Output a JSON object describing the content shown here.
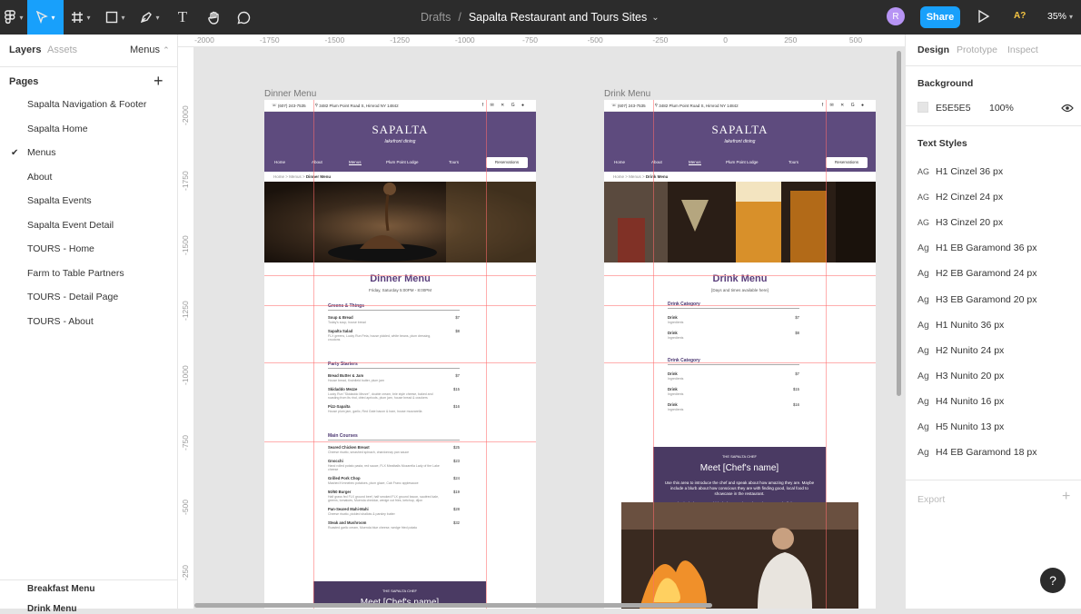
{
  "toolbar": {
    "main_menu_icon": "figma-icon",
    "move_icon": "cursor-icon",
    "frame_icon": "frame-icon",
    "shape_icon": "rectangle-icon",
    "pen_icon": "pen-icon",
    "text_icon": "T",
    "hand_icon": "hand-icon",
    "comment_icon": "comment-icon"
  },
  "breadcrumb": {
    "folder": "Drafts",
    "separator": "/",
    "file": "Sapalta Restaurant and Tours Sites",
    "chevron": "⌄"
  },
  "user": {
    "avatar": "R"
  },
  "share_label": "Share",
  "present_icon": "play-icon",
  "accessibility_label": "A?",
  "zoom_label": "35%",
  "left_panel": {
    "tab_layers": "Layers",
    "tab_assets": "Assets",
    "page_dropdown": "Menus",
    "chevron": "⌃",
    "pages_header": "Pages",
    "add_page": "+",
    "pages": [
      "Sapalta Navigation & Footer",
      "Sapalta Home",
      "Menus",
      "About",
      "Sapalta Events",
      "Sapalta Event Detail",
      "TOURS - Home",
      "Farm to Table Partners",
      "TOURS - Detail Page",
      "TOURS - About"
    ],
    "active_check": "✔",
    "layer_bottom_1": "Breakfast Menu",
    "layer_bottom_2": "Drink Menu"
  },
  "ruler": {
    "top": [
      "-2000",
      "-1750",
      "-1500",
      "-1250",
      "-1000",
      "-750",
      "-500",
      "-250",
      "0",
      "250",
      "500"
    ],
    "left": [
      "-2000",
      "-1750",
      "-1500",
      "-1250",
      "-1000",
      "-750",
      "-500",
      "-250"
    ]
  },
  "frames": [
    {
      "label": "Dinner Menu",
      "phone": "(607) 243-7535",
      "address": "3482 Plum Point Road S, Himrod NY 14842",
      "icons": "f ✉ ✕ G ●",
      "logo": "SAPALTA",
      "tagline": "lakefront dining",
      "nav": [
        "Home",
        "About",
        "Menus",
        "Plum Point Lodge",
        "Tours"
      ],
      "reservations": "Reservations",
      "crumb_home": "Home",
      "crumb_menus": "Menus",
      "crumb_sep": ">",
      "crumb_current": "Dinner Menu",
      "title": "Dinner Menu",
      "subtitle": "Friday, Saturday 5:00PM - 8:00PM",
      "sections": [
        {
          "name": "Greens & Things",
          "items": [
            {
              "name": "Soup & Bread",
              "desc": "Today's soup, house bread",
              "price": "$7"
            },
            {
              "name": "Sapalta Salad",
              "desc": "FLX greens, Lucky Run Feta, house pickled, white beans, plum dressing, croutons",
              "price": "$8"
            }
          ]
        },
        {
          "name": "Party Starters",
          "items": [
            {
              "name": "Bread Butter & Jam",
              "desc": "House bread, Kwinfield butter, plum jam",
              "price": "$7"
            },
            {
              "name": "Skidaddo Mezze",
              "desc": "Lucky Run \"Skidaddo Mezze\", double cream, brie style cheese, baked and roasting from its rind, dried apricots, plum jam, house bread & crackers",
              "price": "$15"
            },
            {
              "name": "Pizz-Sapalta",
              "desc": "House plum jam, garlic, Red Gate bacon & ham, house mozzarella",
              "price": "$16"
            }
          ]
        },
        {
          "name": "Main Courses",
          "items": [
            {
              "name": "Seared Chicken Breast",
              "desc": "Cheese risotto, smashed spinach, chardonnay pan sauce",
              "price": "$25"
            },
            {
              "name": "Gnocchi",
              "desc": "Hand rolled potato pasta, red sauce, FLX Meatballs Mozarella Lady of the Lake cheese",
              "price": "$23"
            },
            {
              "name": "Grilled Pork Chop",
              "desc": "Mashed Kennebec potatoes, plum glaze, Cab Franc applesauce",
              "price": "$24"
            },
            {
              "name": "50/50 Burger",
              "desc": "Half grass fed FLX ground beef, half smoked FLX ground bacon, sautéed kale, greens, tomatoes, Muenda cheddar, wedge cut fries, ketchup, dijon",
              "price": "$19"
            },
            {
              "name": "Pan-Seared Mahi-Mahi",
              "desc": "Cheese risotto, pickled shallots & parsley butter",
              "price": "$28"
            },
            {
              "name": "Steak and Mushroom",
              "desc": "Roasted garlic cream, Muenda blue cheese, wedge fried potato",
              "price": "$32"
            }
          ]
        }
      ],
      "chef_kicker": "THE SAPALTA CHEF",
      "chef_name": "Meet [Chef's name]"
    },
    {
      "label": "Drink Menu",
      "phone": "(607) 243-7535",
      "address": "3482 Plum Point Road S, Himrod NY 14842",
      "icons": "f ✉ ✕ G ●",
      "logo": "SAPALTA",
      "tagline": "lakefront dining",
      "nav": [
        "Home",
        "About",
        "Menus",
        "Plum Point Lodge",
        "Tours"
      ],
      "reservations": "Reservations",
      "crumb_home": "Home",
      "crumb_menus": "Menus",
      "crumb_sep": ">",
      "crumb_current": "Drink Menu",
      "title": "Drink Menu",
      "subtitle": "[Days and times available here]",
      "sections": [
        {
          "name": "Drink Category",
          "items": [
            {
              "name": "Drink",
              "desc": "Ingredients",
              "price": "$7"
            },
            {
              "name": "Drink",
              "desc": "Ingredients",
              "price": "$8"
            }
          ]
        },
        {
          "name": "Drink Category",
          "items": [
            {
              "name": "Drink",
              "desc": "Ingredients",
              "price": "$7"
            },
            {
              "name": "Drink",
              "desc": "Ingredients",
              "price": "$15"
            },
            {
              "name": "Drink",
              "desc": "Ingredients",
              "price": "$16"
            }
          ]
        }
      ],
      "chef_kicker": "THE SAPALTA CHEF",
      "chef_name": "Meet [Chef's name]",
      "chef_p1": "Use this area to introduce the chef and speak about how amazing they are. Maybe include a blurb about how conscious they are with finding good, local food to showcase in the restaurant.",
      "chef_p2": "Maybe include a second blurb that speaks to how they created all the menus themselves and a bit about where they trained or their experience."
    }
  ],
  "right_panel": {
    "tab_design": "Design",
    "tab_prototype": "Prototype",
    "tab_inspect": "Inspect",
    "background_header": "Background",
    "bg_hex": "E5E5E5",
    "bg_opacity": "100%",
    "text_styles_header": "Text Styles",
    "styles": [
      {
        "icon": "AG",
        "name": "H1 Cinzel 36 px"
      },
      {
        "icon": "AG",
        "name": "H2 Cinzel 24 px"
      },
      {
        "icon": "AG",
        "name": "H3 Cinzel 20 px"
      },
      {
        "icon": "Ag",
        "name": "H1 EB Garamond 36 px"
      },
      {
        "icon": "Ag",
        "name": "H2 EB Garamond 24 px"
      },
      {
        "icon": "Ag",
        "name": "H3 EB Garamond 20 px"
      },
      {
        "icon": "Ag",
        "name": "H1 Nunito 36 px"
      },
      {
        "icon": "Ag",
        "name": "H2 Nunito 24 px"
      },
      {
        "icon": "Ag",
        "name": "H3 Nunito 20 px"
      },
      {
        "icon": "Ag",
        "name": "H4 Nunito 16 px"
      },
      {
        "icon": "Ag",
        "name": "H5 Nunito 13 px"
      },
      {
        "icon": "Ag",
        "name": "H4 EB Garamond 18 px"
      }
    ],
    "export_header": "Export",
    "export_add": "+"
  },
  "help_label": "?"
}
